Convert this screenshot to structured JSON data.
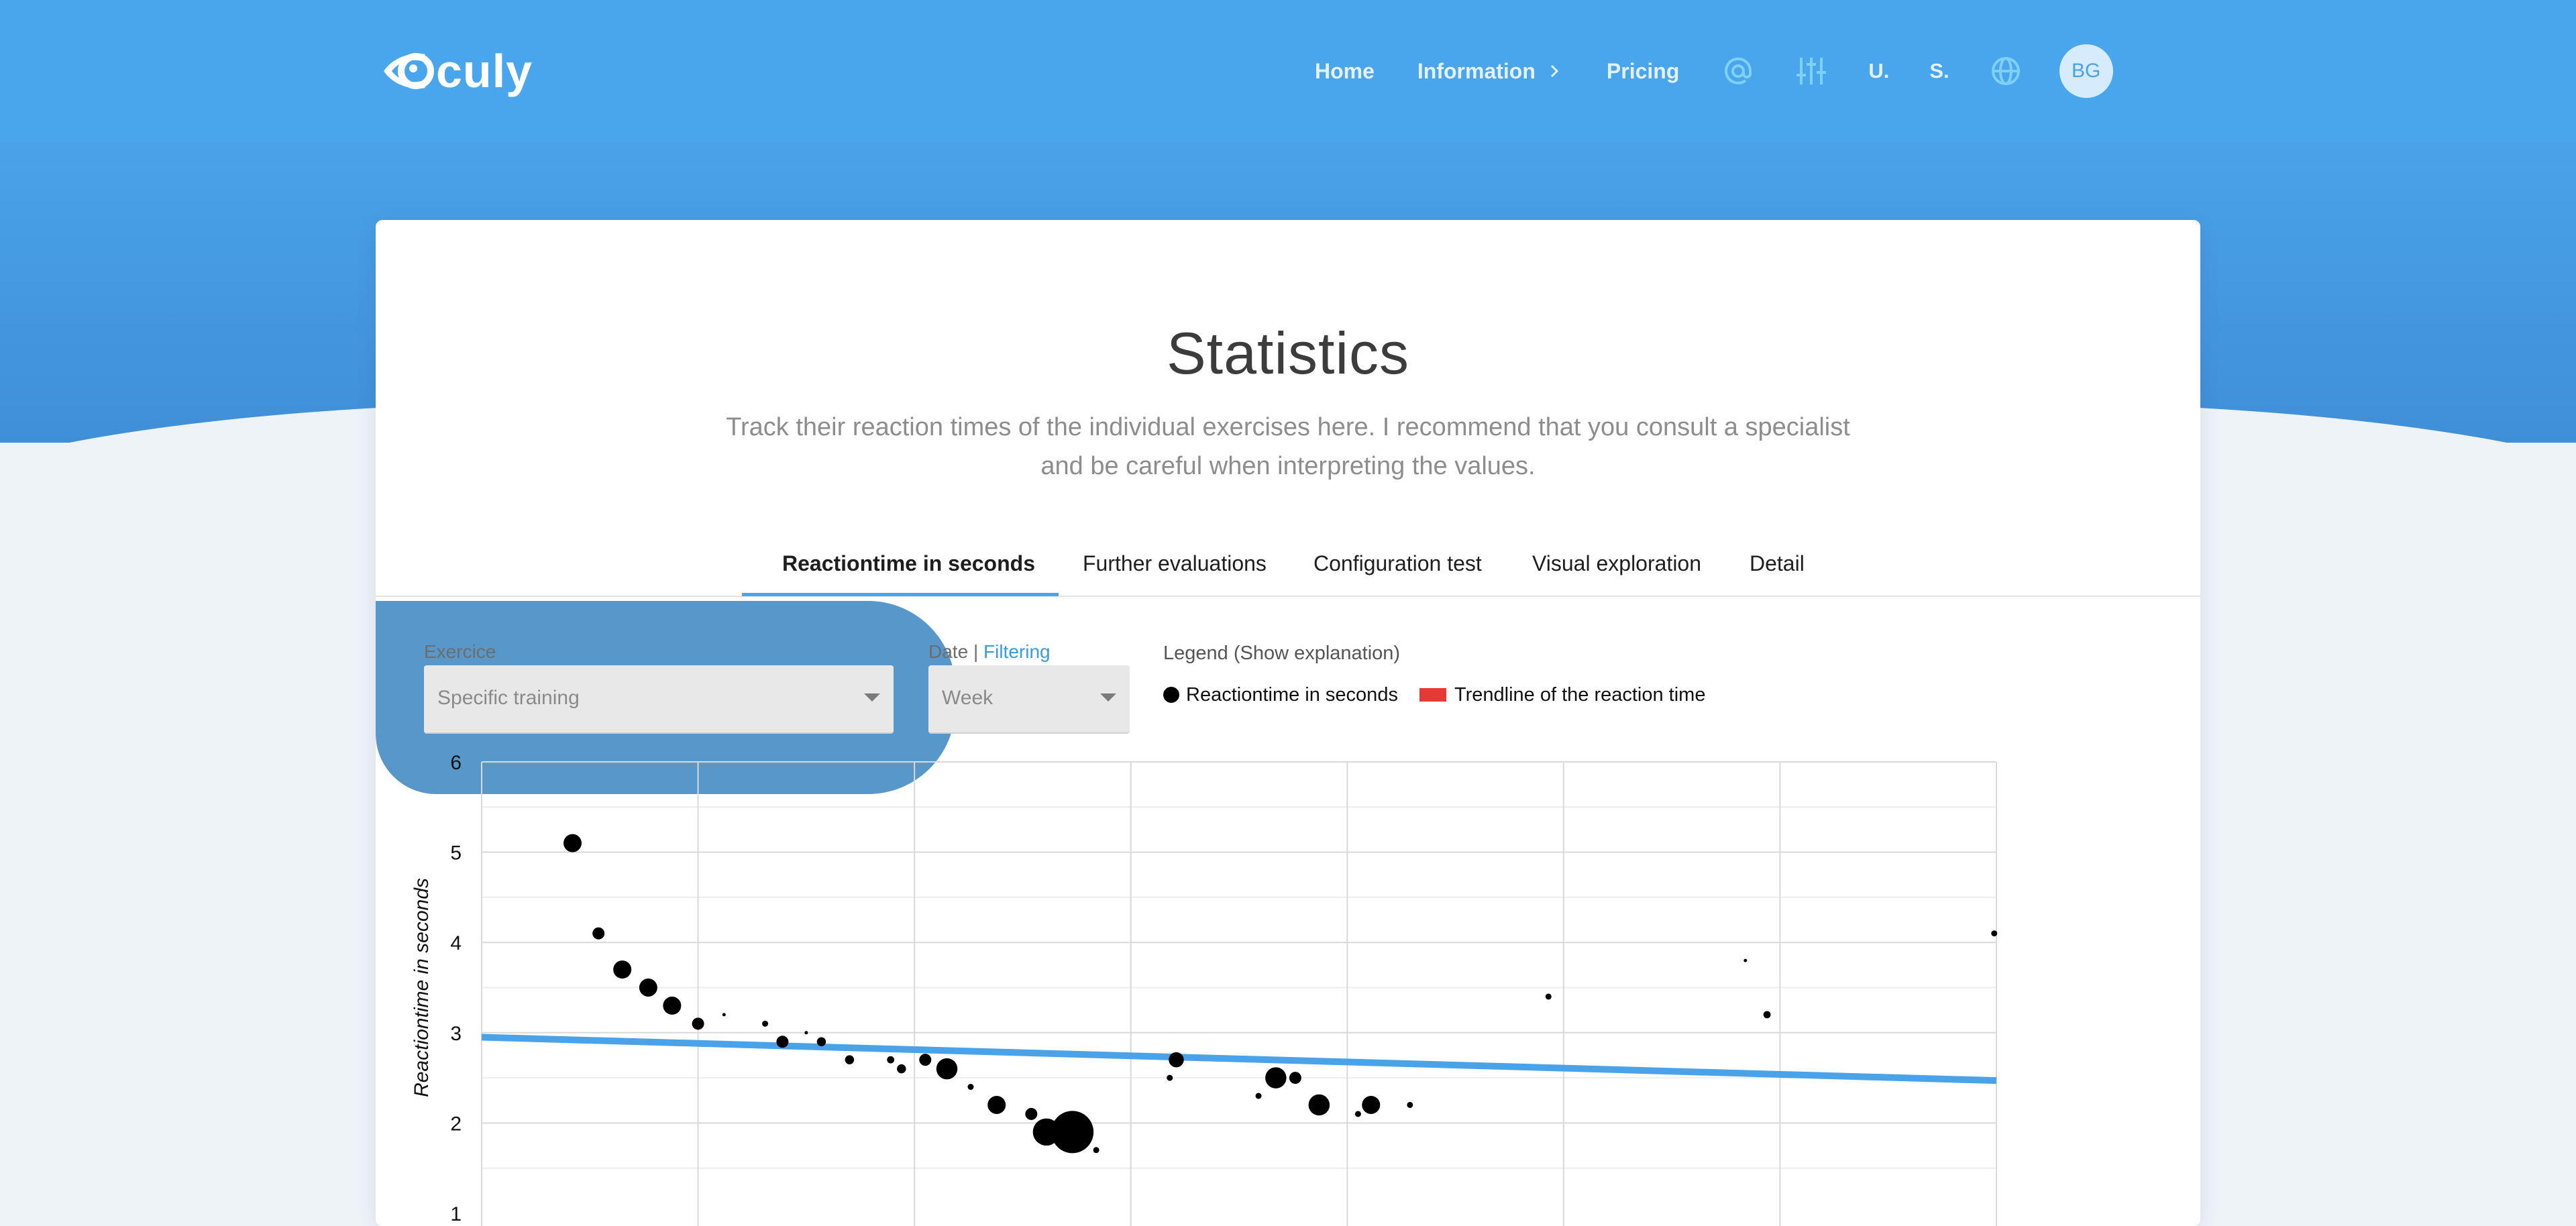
{
  "brand": {
    "name": "culy",
    "logo_letter": "O"
  },
  "nav": {
    "home": "Home",
    "information": "Information",
    "pricing": "Pricing",
    "lang_1": "U.",
    "lang_2": "S.",
    "avatar": "BG"
  },
  "page": {
    "title": "Statistics",
    "subtitle_line1": "Track their reaction times of the individual exercises here. I recommend that you consult a specialist",
    "subtitle_line2": "and be careful when interpreting the values."
  },
  "tabs": [
    {
      "label": "Reactiontime in seconds",
      "active": true
    },
    {
      "label": "Further evaluations"
    },
    {
      "label": "Configuration test"
    },
    {
      "label": "Visual exploration"
    },
    {
      "label": "Detail"
    }
  ],
  "filters": {
    "exercise_label": "Exercice",
    "exercise_value": "Specific training",
    "date_label": "Date",
    "date_separator": "|",
    "filtering_link": "Filtering",
    "period_value": "Week"
  },
  "legend": {
    "title": "Legend (Show explanation)",
    "points": "Reactiontime in seconds",
    "trend": "Trendline of the reaction time"
  },
  "colors": {
    "accent": "#4aa3e9",
    "trendline": "#4aa3e9",
    "legend_trend": "#e53935",
    "overlay": "#4a8fc6"
  },
  "chart_data": {
    "type": "scatter",
    "ylabel": "Reactiontime in seconds",
    "xlabel": "",
    "ylim": [
      1,
      6
    ],
    "xlim": [
      0,
      700
    ],
    "yticks": [
      6,
      5,
      4,
      3,
      2,
      1
    ],
    "grid": true,
    "trendline": {
      "x": [
        0,
        700
      ],
      "y": [
        2.95,
        2.47
      ]
    },
    "points": [
      {
        "x": 42,
        "y": 5.1,
        "size": 3
      },
      {
        "x": 54,
        "y": 4.1,
        "size": 2
      },
      {
        "x": 65,
        "y": 3.7,
        "size": 3
      },
      {
        "x": 77,
        "y": 3.5,
        "size": 3
      },
      {
        "x": 88,
        "y": 3.3,
        "size": 3
      },
      {
        "x": 100,
        "y": 3.1,
        "size": 2
      },
      {
        "x": 112,
        "y": 3.2,
        "size": 0.4
      },
      {
        "x": 131,
        "y": 3.1,
        "size": 1
      },
      {
        "x": 139,
        "y": 2.9,
        "size": 2
      },
      {
        "x": 150,
        "y": 3.0,
        "size": 0.4
      },
      {
        "x": 157,
        "y": 2.9,
        "size": 1.5
      },
      {
        "x": 170,
        "y": 2.7,
        "size": 1.5
      },
      {
        "x": 189,
        "y": 2.7,
        "size": 1.2
      },
      {
        "x": 194,
        "y": 2.6,
        "size": 1.5
      },
      {
        "x": 205,
        "y": 2.7,
        "size": 2
      },
      {
        "x": 215,
        "y": 2.6,
        "size": 3.5
      },
      {
        "x": 226,
        "y": 2.4,
        "size": 1
      },
      {
        "x": 238,
        "y": 2.2,
        "size": 3
      },
      {
        "x": 254,
        "y": 2.1,
        "size": 2
      },
      {
        "x": 261,
        "y": 1.9,
        "size": 4.5
      },
      {
        "x": 273,
        "y": 1.9,
        "size": 7
      },
      {
        "x": 284,
        "y": 1.7,
        "size": 1
      },
      {
        "x": 318,
        "y": 2.5,
        "size": 1
      },
      {
        "x": 321,
        "y": 2.7,
        "size": 2.5
      },
      {
        "x": 359,
        "y": 2.3,
        "size": 1
      },
      {
        "x": 367,
        "y": 2.5,
        "size": 3.5
      },
      {
        "x": 376,
        "y": 2.5,
        "size": 2
      },
      {
        "x": 387,
        "y": 2.2,
        "size": 3.5
      },
      {
        "x": 405,
        "y": 2.1,
        "size": 1
      },
      {
        "x": 411,
        "y": 2.2,
        "size": 3
      },
      {
        "x": 429,
        "y": 2.2,
        "size": 1
      },
      {
        "x": 493,
        "y": 3.4,
        "size": 1
      },
      {
        "x": 584,
        "y": 3.8,
        "size": 0.5
      },
      {
        "x": 594,
        "y": 3.2,
        "size": 1.2
      },
      {
        "x": 699,
        "y": 4.1,
        "size": 1
      }
    ]
  }
}
